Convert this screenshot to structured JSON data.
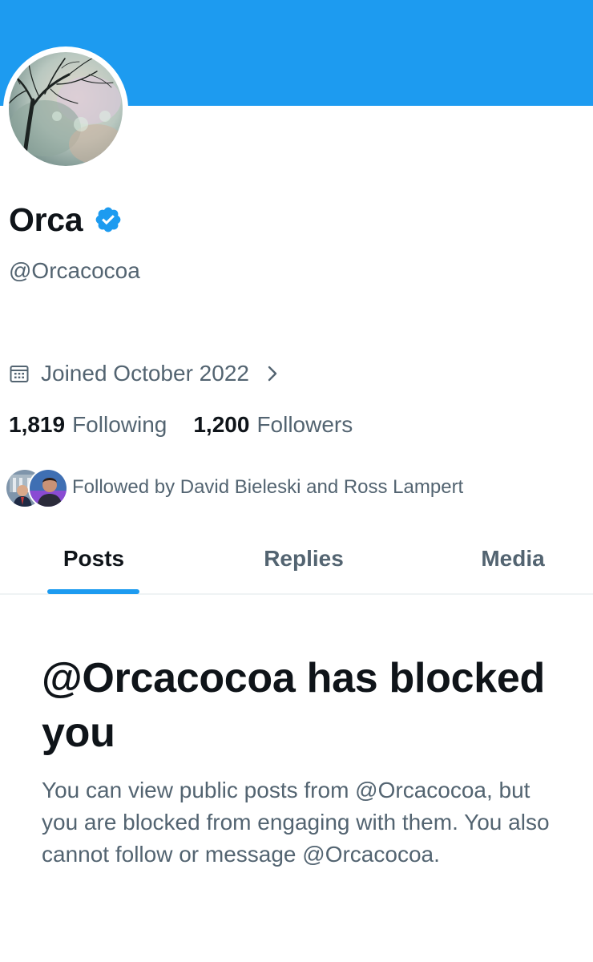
{
  "colors": {
    "banner": "#1d9bf0",
    "accent": "#1d9bf0",
    "primary_text": "#0f1419",
    "secondary_text": "#536471",
    "divider": "#eff3f4"
  },
  "profile": {
    "display_name": "Orca",
    "verified_icon": "verified-badge-icon",
    "handle": "@Orcacocoa",
    "joined": "Joined October 2022",
    "following_count": "1,819",
    "following_label": "Following",
    "followers_count": "1,200",
    "followers_label": "Followers",
    "followed_by": "Followed by David Bieleski and Ross Lampert"
  },
  "tabs": [
    {
      "label": "Posts",
      "active": true
    },
    {
      "label": "Replies",
      "active": false
    },
    {
      "label": "Media",
      "active": false
    }
  ],
  "blocked": {
    "title": "@Orcacocoa has blocked you",
    "message": "You can view public posts from @Orcacocoa, but you are blocked from engaging with them. You also cannot follow or message @Orcacocoa."
  }
}
